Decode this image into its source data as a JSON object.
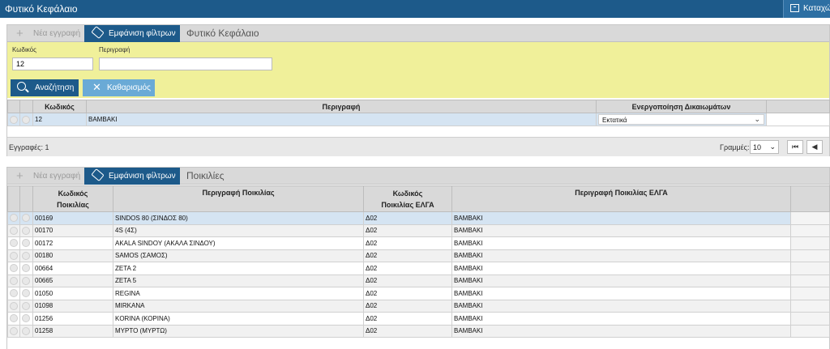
{
  "app": {
    "title": "Φυτικό Κεφάλαιο",
    "save_label": "Καταχώρηση"
  },
  "header_panel": {
    "toolbar": {
      "new_label": "Νέα εγγραφή",
      "filter_label": "Εμφάνιση φίλτρων",
      "caption": "Φυτικό Κεφάλαιο"
    },
    "filters": {
      "code_label": "Κωδικός",
      "code_value": "12",
      "desc_label": "Περιγραφή",
      "desc_value": "",
      "search_label": "Αναζήτηση",
      "clear_label": "Καθαρισμός"
    },
    "columns": {
      "code": "Κωδικός",
      "description": "Περιγραφή",
      "rights": "Ενεργοποίηση Δικαιωμάτων"
    },
    "rows": [
      {
        "code": "12",
        "description": "ΒΑΜΒΑΚΙ",
        "rights": "Εκτατικά"
      }
    ],
    "footer": {
      "records": "Εγγραφές: 1",
      "rows_label": "Γραμμές:",
      "rows_value": "10"
    }
  },
  "variety_panel": {
    "toolbar": {
      "new_label": "Νέα εγγραφή",
      "filter_label": "Εμφάνιση φίλτρων",
      "caption": "Ποικιλίες"
    },
    "columns": {
      "code_1": "Κωδικός",
      "code_2": "Ποικιλίας",
      "description": "Περιγραφή Ποικιλίας",
      "elga_code_1": "Κωδικός",
      "elga_code_2": "Ποικιλίας ΕΛΓΑ",
      "elga_description": "Περιγραφή Ποικιλίας ΕΛΓΑ"
    },
    "rows": [
      {
        "code": "00169",
        "description": "SINDOS 80 (ΣΙΝΔΟΣ 80)",
        "elga_code": "Δ02",
        "elga_description": "ΒΑΜΒΑΚΙ"
      },
      {
        "code": "00170",
        "description": "4S (4Σ)",
        "elga_code": "Δ02",
        "elga_description": "ΒΑΜΒΑΚΙ"
      },
      {
        "code": "00172",
        "description": "AKALA SINDOY (ΑΚΑΛΑ ΣΙΝΔΟΥ)",
        "elga_code": "Δ02",
        "elga_description": "ΒΑΜΒΑΚΙ"
      },
      {
        "code": "00180",
        "description": "SAMOS (ΣΑΜΟΣ)",
        "elga_code": "Δ02",
        "elga_description": "ΒΑΜΒΑΚΙ"
      },
      {
        "code": "00664",
        "description": "ZETA 2",
        "elga_code": "Δ02",
        "elga_description": "ΒΑΜΒΑΚΙ"
      },
      {
        "code": "00665",
        "description": "ZETA 5",
        "elga_code": "Δ02",
        "elga_description": "ΒΑΜΒΑΚΙ"
      },
      {
        "code": "01050",
        "description": "REGINA",
        "elga_code": "Δ02",
        "elga_description": "ΒΑΜΒΑΚΙ"
      },
      {
        "code": "01098",
        "description": "MIRKANA",
        "elga_code": "Δ02",
        "elga_description": "ΒΑΜΒΑΚΙ"
      },
      {
        "code": "01256",
        "description": "KORINA (ΚΟΡΙΝΑ)",
        "elga_code": "Δ02",
        "elga_description": "ΒΑΜΒΑΚΙ"
      },
      {
        "code": "01258",
        "description": "ΜΥΡΤΟ (ΜΥΡΤΩ)",
        "elga_code": "Δ02",
        "elga_description": "ΒΑΜΒΑΚΙ"
      }
    ]
  },
  "colors": {
    "primary": "#1d5a8a",
    "filter_bg": "#f0f09a",
    "clear_button": "#6aaad6",
    "highlight_row": "#d5e4f2"
  },
  "icons": {
    "save": "archive-icon",
    "new": "plus-icon",
    "filter": "tag-icon",
    "search": "magnifier-icon",
    "clear": "close-icon",
    "dropdown": "chevron-down-icon"
  }
}
